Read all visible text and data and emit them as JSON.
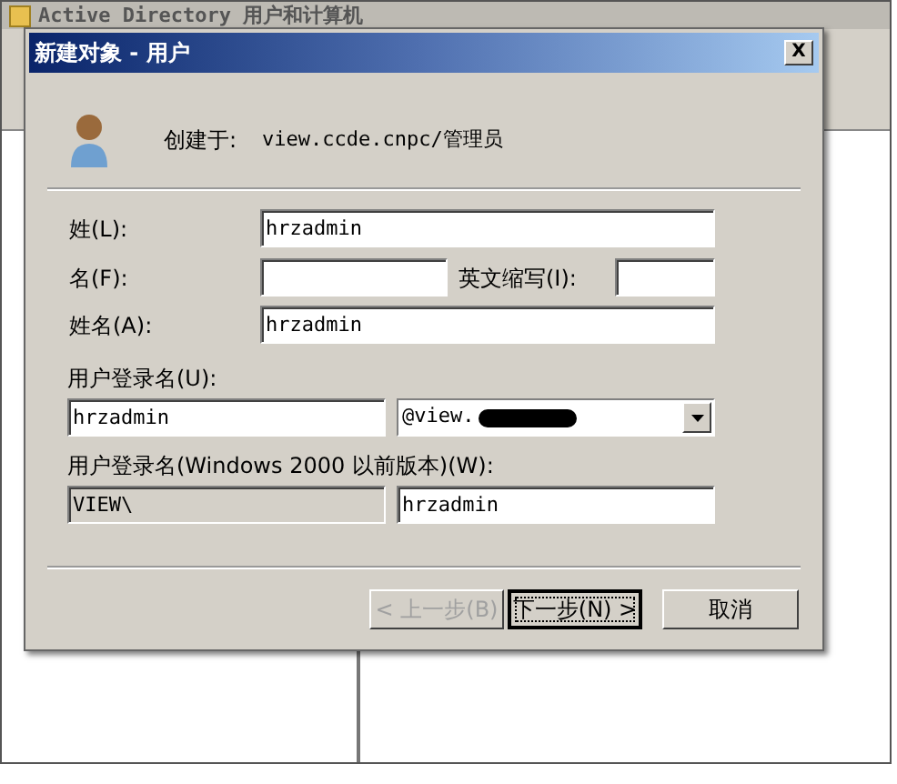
{
  "background_window": {
    "title": "Active Directory 用户和计算机"
  },
  "dialog": {
    "title": "新建对象 - 用户",
    "close_label": "X",
    "created_in_label": "创建于:",
    "created_in_value": "view.ccde.cnpc/管理员",
    "last_name": {
      "label": "姓(L):",
      "value": "hrzadmin"
    },
    "first_name": {
      "label": "名(F):"
    },
    "initials": {
      "label": "英文缩写(I):"
    },
    "full_name": {
      "label": "姓名(A):",
      "value": "hrzadmin"
    },
    "logon_name": {
      "label": "用户登录名(U):",
      "value": "hrzadmin",
      "domain": "@view.",
      "domain_redacted": true
    },
    "pre2000": {
      "label": "用户登录名(Windows 2000 以前版本)(W):",
      "domain": "VIEW\\",
      "value": "hrzadmin"
    },
    "buttons": [
      {
        "label": "< 上一步(B)",
        "disabled": true,
        "focused": false
      },
      {
        "label": "下一步(N) >",
        "disabled": false,
        "focused": true
      },
      {
        "label": "取消",
        "disabled": false,
        "focused": false
      }
    ]
  }
}
